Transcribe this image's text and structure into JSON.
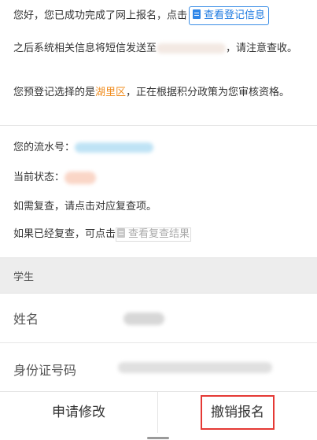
{
  "message": {
    "line1_prefix": "您好，您已成功完成了网上报名，点击",
    "view_button_label": "查看登记信息",
    "line2_prefix": "之后系统相关信息将短信发送至",
    "line2_suffix": "，请注意查收。",
    "line3_prefix": "您预登记选择的是",
    "district": "湖里区",
    "line3_suffix": "，正在根据积分政策为您审核资格。"
  },
  "info": {
    "serial_label": "您的流水号：",
    "status_label": "当前状态：",
    "recheck_hint": "如需复查，请点击对应复查项。",
    "rechecked_prefix": "如果已经复查，可点击",
    "view_result_label": "查看复查结果"
  },
  "section": {
    "title": "学生",
    "name_label": "姓名",
    "id_label": "身份证号码"
  },
  "bottom_bar": {
    "modify_label": "申请修改",
    "cancel_label": "撤销报名"
  },
  "colors": {
    "accent": "#1f7be0",
    "highlight": "#f08c1e",
    "annotation_box": "#e53935"
  }
}
